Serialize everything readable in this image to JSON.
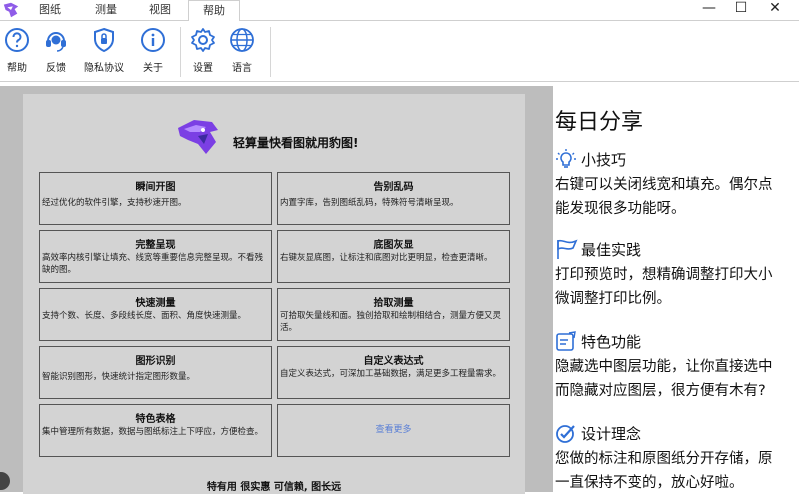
{
  "tabs": [
    {
      "label": "图纸"
    },
    {
      "label": "测量"
    },
    {
      "label": "视图"
    },
    {
      "label": "帮助"
    }
  ],
  "window_controls": {
    "minimize": "—",
    "maximize": "☐",
    "close": "✕"
  },
  "ribbon": {
    "help": "帮助",
    "feedback": "反馈",
    "privacy": "隐私协议",
    "about": "关于",
    "settings": "设置",
    "language": "语言"
  },
  "card": {
    "slogan": "轻算量快看图就用豹图!",
    "features": [
      {
        "title": "瞬间开图",
        "desc": "经过优化的软件引擎，支持秒速开图。"
      },
      {
        "title": "告别乱码",
        "desc": "内置字库，告别图纸乱码，特殊符号清晰呈现。"
      },
      {
        "title": "完整呈现",
        "desc": "高效率内核引擎让填充、线宽等重要信息完整呈现。不看残缺的图。"
      },
      {
        "title": "底图灰显",
        "desc": "右键灰显底图，让标注和底图对比更明显，检查更清晰。"
      },
      {
        "title": "快速测量",
        "desc": "支持个数、长度、多段线长度、面积、角度快速测量。"
      },
      {
        "title": "拾取测量",
        "desc": "可拾取矢量线和面。独创拾取和绘制相结合，测量方便又灵活。"
      },
      {
        "title": "图形识别",
        "desc": "智能识别图形，快速统计指定图形数量。"
      },
      {
        "title": "自定义表达式",
        "desc": "自定义表达式，可深加工基础数据，满足更多工程量需求。"
      },
      {
        "title": "特色表格",
        "desc": "集中管理所有数据，数据与图纸标注上下呼应，方便检查。"
      }
    ],
    "more": "查看更多",
    "footer": "特有用 很实惠 可信赖, 图长远"
  },
  "side": {
    "title": "每日分享",
    "sections": [
      {
        "heading": "小技巧",
        "icon": "bulb-icon",
        "lines": [
          "右键可以关闭线宽和填充。偶尔点",
          "能发现很多功能呀。"
        ]
      },
      {
        "heading": "最佳实践",
        "icon": "flag-icon",
        "lines": [
          "打印预览时，想精确调整打印大小",
          "微调整打印比例。"
        ]
      },
      {
        "heading": "特色功能",
        "icon": "checklist-icon",
        "lines": [
          "隐藏选中图层功能，让你直接选中",
          "而隐藏对应图层，很方便有木有?"
        ]
      },
      {
        "heading": "设计理念",
        "icon": "target-check-icon",
        "lines": [
          "您做的标注和原图纸分开存储，原",
          "一直保持不变的，放心好啦。"
        ]
      }
    ]
  },
  "colors": {
    "accent": "#2f6fd6",
    "brand_purple": "#7b3fe4",
    "link": "#5a7fd6"
  }
}
